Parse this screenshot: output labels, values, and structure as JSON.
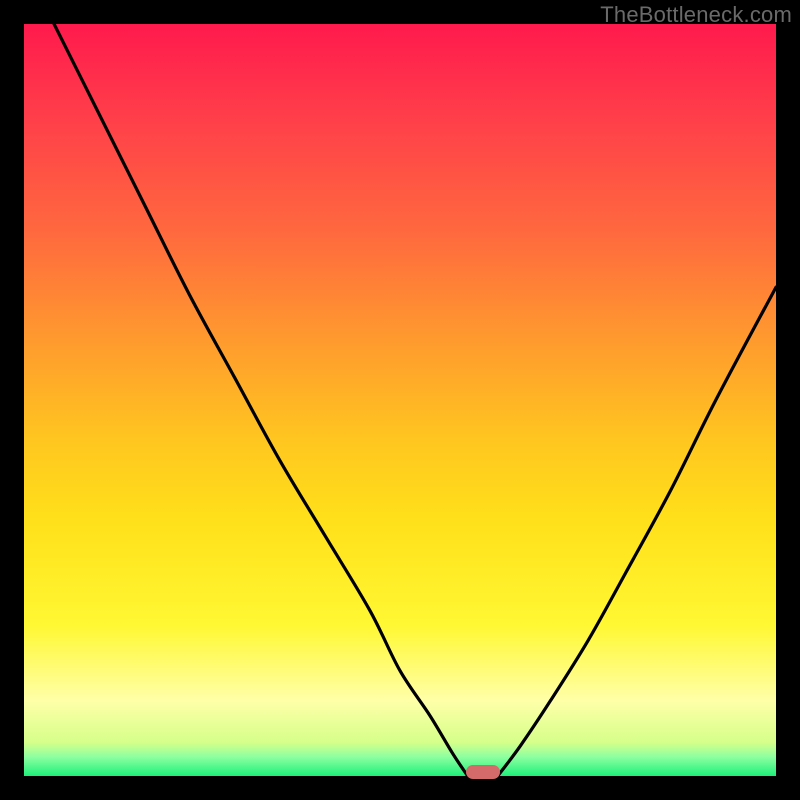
{
  "watermark": {
    "text": "TheBottleneck.com"
  },
  "chart_data": {
    "type": "line",
    "title": "",
    "xlabel": "",
    "ylabel": "",
    "xlim": [
      0,
      100
    ],
    "ylim": [
      0,
      100
    ],
    "grid": false,
    "legend": false,
    "series": [
      {
        "name": "curve-left",
        "x": [
          4,
          10,
          16,
          22,
          28,
          34,
          40,
          46,
          50,
          54,
          57,
          59
        ],
        "y": [
          100,
          88,
          76,
          64,
          53,
          42,
          32,
          22,
          14,
          8,
          3,
          0
        ]
      },
      {
        "name": "curve-right",
        "x": [
          63,
          66,
          70,
          75,
          80,
          86,
          92,
          100
        ],
        "y": [
          0,
          4,
          10,
          18,
          27,
          38,
          50,
          65
        ]
      }
    ],
    "annotations": [
      {
        "name": "minimum-marker",
        "x": 61,
        "y": 0.5
      }
    ],
    "background_gradient": {
      "direction": "vertical",
      "stops": [
        {
          "pos": 0.0,
          "color": "#ff1a4d"
        },
        {
          "pos": 0.12,
          "color": "#ff3d4a"
        },
        {
          "pos": 0.28,
          "color": "#ff6a3e"
        },
        {
          "pos": 0.42,
          "color": "#ff9a2e"
        },
        {
          "pos": 0.56,
          "color": "#ffc81f"
        },
        {
          "pos": 0.66,
          "color": "#ffe01a"
        },
        {
          "pos": 0.8,
          "color": "#fff833"
        },
        {
          "pos": 0.9,
          "color": "#ffffa8"
        },
        {
          "pos": 0.955,
          "color": "#d6ff8a"
        },
        {
          "pos": 0.975,
          "color": "#8cffa0"
        },
        {
          "pos": 1.0,
          "color": "#1df07a"
        }
      ]
    }
  }
}
